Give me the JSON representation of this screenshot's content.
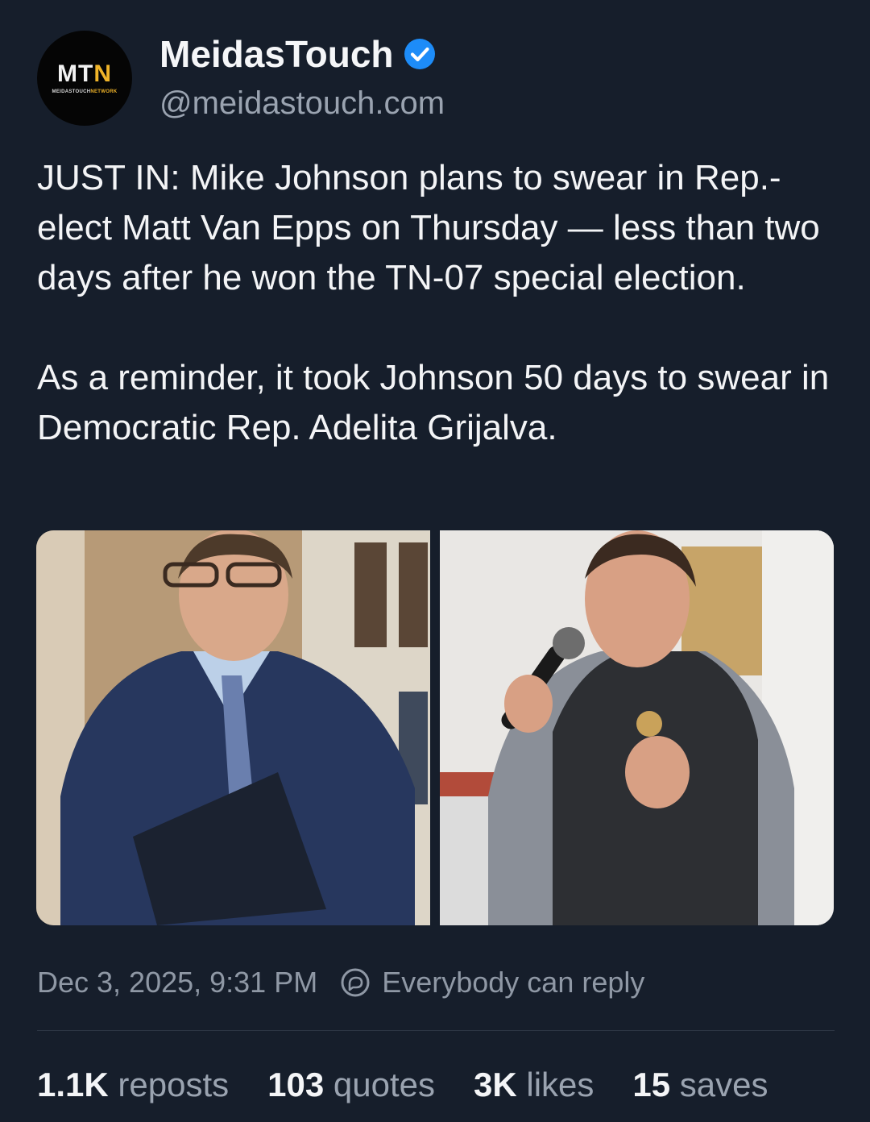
{
  "author": {
    "display_name": "MeidasTouch",
    "handle": "@meidastouch.com",
    "verified": true,
    "avatar_logo": {
      "main_prefix": "MT",
      "main_accent": "N",
      "sub_prefix": "MEIDASTOUCH",
      "sub_accent": "NETWORK"
    }
  },
  "post": {
    "paragraphs": [
      "JUST IN: Mike Johnson plans to swear in Rep.-elect Matt Van Epps on Thursday — less than two days after he won the TN-07 special election.",
      "As a reminder, it took Johnson 50 days to swear in Democratic Rep. Adelita Grijalva."
    ],
    "images": [
      {
        "name": "photo-man-in-suit-with-folder"
      },
      {
        "name": "photo-man-speaking-into-microphone"
      }
    ]
  },
  "meta": {
    "timestamp": "Dec 3, 2025, 9:31 PM",
    "reply_setting": "Everybody can reply",
    "reply_icon": "reply-permission-icon"
  },
  "stats": [
    {
      "count": "1.1K",
      "label": "reposts"
    },
    {
      "count": "103",
      "label": "quotes"
    },
    {
      "count": "3K",
      "label": "likes"
    },
    {
      "count": "15",
      "label": "saves"
    }
  ],
  "colors": {
    "background": "#161e2b",
    "verified_badge": "#1d8cf8",
    "logo_accent": "#f0b429",
    "muted_text": "#9aa3b0"
  }
}
